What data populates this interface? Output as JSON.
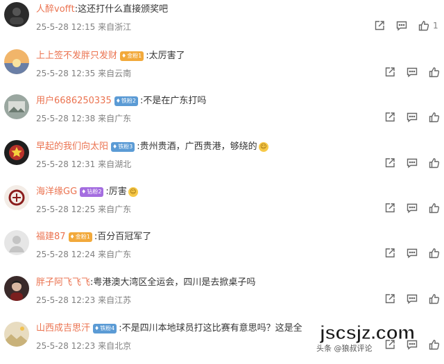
{
  "comments": [
    {
      "user": "人醉vofft",
      "badge": "",
      "badge_color": "",
      "text": ":这还打什么直接颁奖吧",
      "emoji": "",
      "date": "25-5-28 12:15",
      "location": "来自浙江",
      "avatar_color": "#2b2b2b",
      "avatar_icon": "dark-avatar-icon",
      "likes": "1"
    },
    {
      "user": "上上签不发胖只发财",
      "badge": "金粉1",
      "badge_color": "#f2a93b",
      "text": ":太厉害了",
      "emoji": "",
      "date": "25-5-28 12:35",
      "location": "来自云南",
      "avatar_color": "#e39a4a",
      "avatar_icon": "sunset-avatar-icon",
      "likes": ""
    },
    {
      "user": "用户6686250335",
      "badge": "铁粉2",
      "badge_color": "#5b9bd5",
      "text": ":不是在广东打吗",
      "emoji": "",
      "date": "25-5-28 12:38",
      "location": "来自广东",
      "avatar_color": "#9aa7a0",
      "avatar_icon": "photo-avatar-icon",
      "likes": ""
    },
    {
      "user": "早起的我们向太阳",
      "badge": "铁粉3",
      "badge_color": "#5b9bd5",
      "text": ":贵州贵酒，广西贵港，够绕的",
      "emoji": "emoji",
      "date": "25-5-28 12:31",
      "location": "来自湖北",
      "avatar_color": "#1e1e1e",
      "avatar_icon": "star-avatar-icon",
      "likes": ""
    },
    {
      "user": "海洋缘GG",
      "badge": "钻粉2",
      "badge_color": "#a46de0",
      "text": ":厉害",
      "emoji": "emoji",
      "date": "25-5-28 12:25",
      "location": "来自广东",
      "avatar_color": "#f3ece6",
      "avatar_icon": "emblem-avatar-icon",
      "likes": ""
    },
    {
      "user": "福建87",
      "badge": "金粉1",
      "badge_color": "#f2a93b",
      "text": ":百分百冠军了",
      "emoji": "",
      "date": "25-5-28 12:24",
      "location": "来自广东",
      "avatar_color": "#e6e6e6",
      "avatar_icon": "default-avatar-icon",
      "likes": ""
    },
    {
      "user": "胖子阿飞飞飞",
      "badge": "",
      "badge_color": "",
      "text": ":粤港澳大湾区全运会，四川是去掀桌子吗",
      "emoji": "",
      "date": "25-5-28 12:23",
      "location": "来自江苏",
      "avatar_color": "#3a2a2a",
      "avatar_icon": "portrait-avatar-icon",
      "likes": ""
    },
    {
      "user": "山西成吉思汗",
      "badge": "铁粉4",
      "badge_color": "#5b9bd5",
      "text": ":不是四川本地球员打这比赛有意思吗？这是全",
      "emoji": "",
      "date": "25-5-28 12:23",
      "location": "来自北京",
      "avatar_color": "#c9b27a",
      "avatar_icon": "landscape-avatar-icon",
      "likes": ""
    }
  ],
  "watermark": {
    "big": "jscsjz.com",
    "small": "头条 @狼叔评论"
  },
  "icons": {
    "share": "share-icon",
    "comment": "comment-icon",
    "like": "thumbs-up-icon"
  },
  "colors": {
    "username": "#eb7350",
    "meta": "#808080",
    "text": "#333333"
  }
}
